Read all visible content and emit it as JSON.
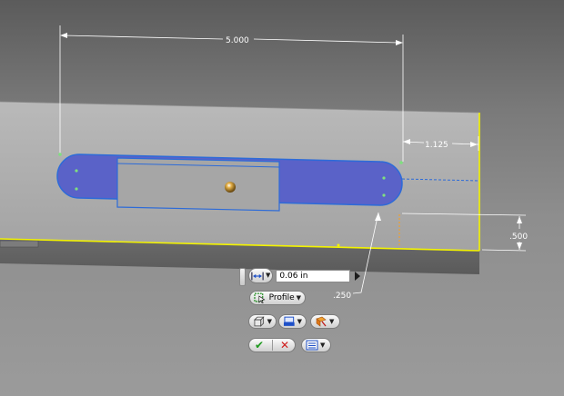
{
  "dimensions": {
    "overall_length": "5.000",
    "edge_offset": "1.125",
    "height_offset": ".500",
    "radius": ".250"
  },
  "mini_toolbar": {
    "distance_mode_icon": "distance-arrows-icon",
    "distance_value": "0.06 in",
    "profile_label": "Profile",
    "profile_icon": "profile-select-icon",
    "solid_icon": "solid-cube-icon",
    "output_icon": "output-surface-icon",
    "direction_icon": "direction-flip-icon",
    "ok_icon": "check-icon",
    "cancel_icon": "cancel-x-icon",
    "options_icon": "options-menu-icon"
  },
  "colors": {
    "profile_fill": "#5a62c8",
    "sketch_line": "#2d6bd8",
    "edge_highlight": "#f3f300",
    "ok_green": "#1f9a1f",
    "cancel_red": "#d02020"
  }
}
